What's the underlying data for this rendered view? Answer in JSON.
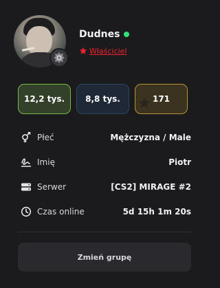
{
  "profile": {
    "username": "Dudnes",
    "online": true,
    "role": "Właściciel",
    "role_color": "#f0242f",
    "avatar": "avatar-photo",
    "rank_badge": "rank-icon"
  },
  "stats": [
    {
      "value": "12,2 tys.",
      "color": "#7eb945"
    },
    {
      "value": "8,8 tys.",
      "color": "#2f4660"
    },
    {
      "value": "171",
      "color": "#b59734",
      "icon": "star-icon"
    }
  ],
  "details": [
    {
      "icon": "gender-icon",
      "label": "Płeć",
      "value": "Mężczyzna / Male"
    },
    {
      "icon": "signature-icon",
      "label": "Imię",
      "value": "Piotr"
    },
    {
      "icon": "server-icon",
      "label": "Serwer",
      "value": "[CS2] MIRAGE #2"
    },
    {
      "icon": "clock-icon",
      "label": "Czas online",
      "value": "5d 15h 1m 20s"
    }
  ],
  "actions": {
    "change_group_label": "Zmień grupę"
  }
}
